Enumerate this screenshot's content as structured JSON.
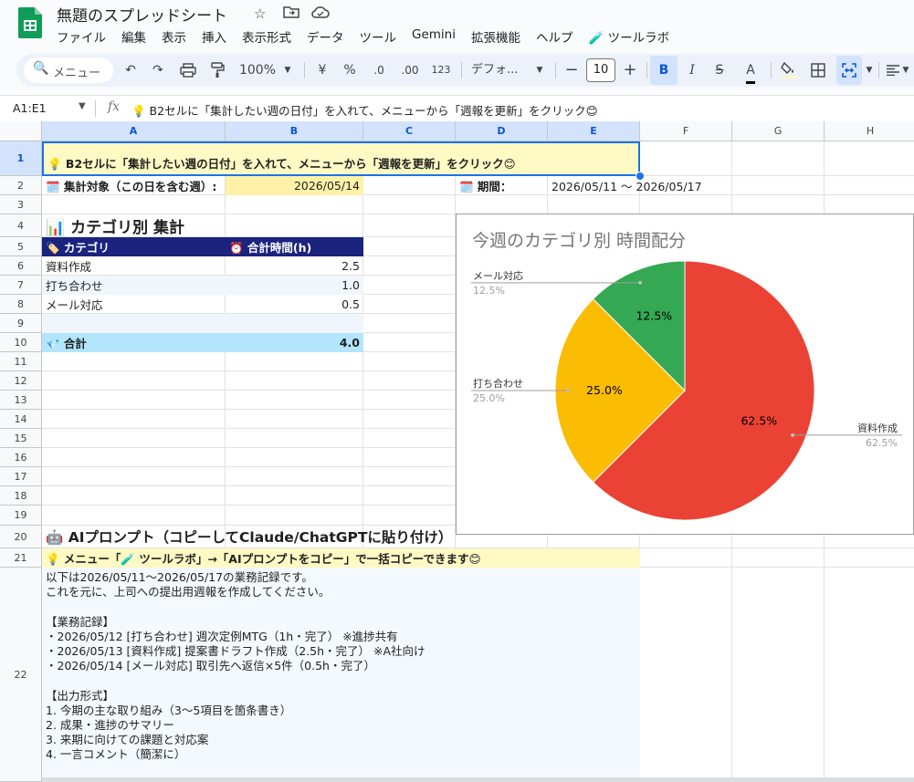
{
  "app": {
    "doc_title": "無題のスプレッドシート",
    "menu": [
      "ファイル",
      "編集",
      "表示",
      "挿入",
      "表示形式",
      "データ",
      "ツール",
      "Gemini",
      "拡張機能",
      "ヘルプ",
      "🧪 ツールラボ"
    ]
  },
  "toolbar": {
    "search_placeholder": "メニュー",
    "zoom": "100%",
    "currency": "¥",
    "percent": "%",
    "dec_decrease": ".0",
    "dec_increase": ".00",
    "number_format": "123",
    "font": "デフォ...",
    "font_size": "10",
    "minus": "−",
    "plus": "+",
    "bold": "B",
    "italic": "I",
    "strike": "S",
    "text_color": "A"
  },
  "formula_bar": {
    "name_box": "A1:E1",
    "fx": "fx",
    "content": "💡 B2セルに「集計したい週の日付」を入れて、メニューから「週報を更新」をクリック😊"
  },
  "columns": [
    "A",
    "B",
    "C",
    "D",
    "E",
    "F",
    "G",
    "H"
  ],
  "rows": [
    "1",
    "2",
    "3",
    "4",
    "5",
    "6",
    "7",
    "8",
    "9",
    "10",
    "11",
    "12",
    "13",
    "14",
    "15",
    "16",
    "17",
    "18",
    "19",
    "20",
    "21",
    "22"
  ],
  "sheet": {
    "r1_banner": "💡 B2セルに「集計したい週の日付」を入れて、メニューから「週報を更新」をクリック😊",
    "r2_label": "🗓️ 集計対象（この日を含む週）:",
    "r2_date": "2026/05/14",
    "r2_period_label": "🗓️ 期間：",
    "r2_period_value": "2026/05/11 〜 2026/05/17",
    "r4_heading": "📊 カテゴリ別 集計",
    "table_header_category": "🏷️ カテゴリ",
    "table_header_hours": "⏰ 合計時間(h)",
    "rows": [
      {
        "category": "資料作成",
        "hours": "2.5"
      },
      {
        "category": "打ち合わせ",
        "hours": "1.0"
      },
      {
        "category": "メール対応",
        "hours": "0.5"
      }
    ],
    "total_label": "💎 合計",
    "total_value": "4.0",
    "r20_heading": "🤖 AIプロンプト（コピーしてClaude/ChatGPTに貼り付け）",
    "r21_banner": "💡 メニュー「🧪 ツールラボ」→「AIプロンプトをコピー」で一括コピーできます😊",
    "prompt_lines": [
      "以下は2026/05/11〜2026/05/17の業務記録です。",
      "これを元に、上司への提出用週報を作成してください。",
      "",
      "【業務記録】",
      "・2026/05/12 [打ち合わせ] 週次定例MTG（1h・完了） ※進捗共有",
      "・2026/05/13 [資料作成] 提案書ドラフト作成（2.5h・完了） ※A社向け",
      "・2026/05/14 [メール対応] 取引先へ返信×5件（0.5h・完了）",
      "",
      "【出力形式】",
      "1. 今期の主な取り組み（3〜5項目を箇条書き）",
      "2. 成果・進捗のサマリー",
      "3. 来期に向けての課題と対応案",
      "4. 一言コメント（簡潔に）"
    ]
  },
  "chart_data": {
    "type": "pie",
    "title": "今週のカテゴリ別 時間配分",
    "slices": [
      {
        "label": "資料作成",
        "value": 62.5,
        "pct_label": "62.5%",
        "color": "#ea4335"
      },
      {
        "label": "打ち合わせ",
        "value": 25.0,
        "pct_label": "25.0%",
        "color": "#fbbc04"
      },
      {
        "label": "メール対応",
        "value": 12.5,
        "pct_label": "12.5%",
        "color": "#34a853"
      }
    ]
  },
  "colors": {
    "banner": "#fff9c4",
    "table_header": "#1a237e",
    "table_header_text": "#ffffff",
    "row_alt": "#f1f6fc",
    "total": "#b3e5fc",
    "date_cell": "#fff2a8",
    "selection": "#1a73e8"
  }
}
